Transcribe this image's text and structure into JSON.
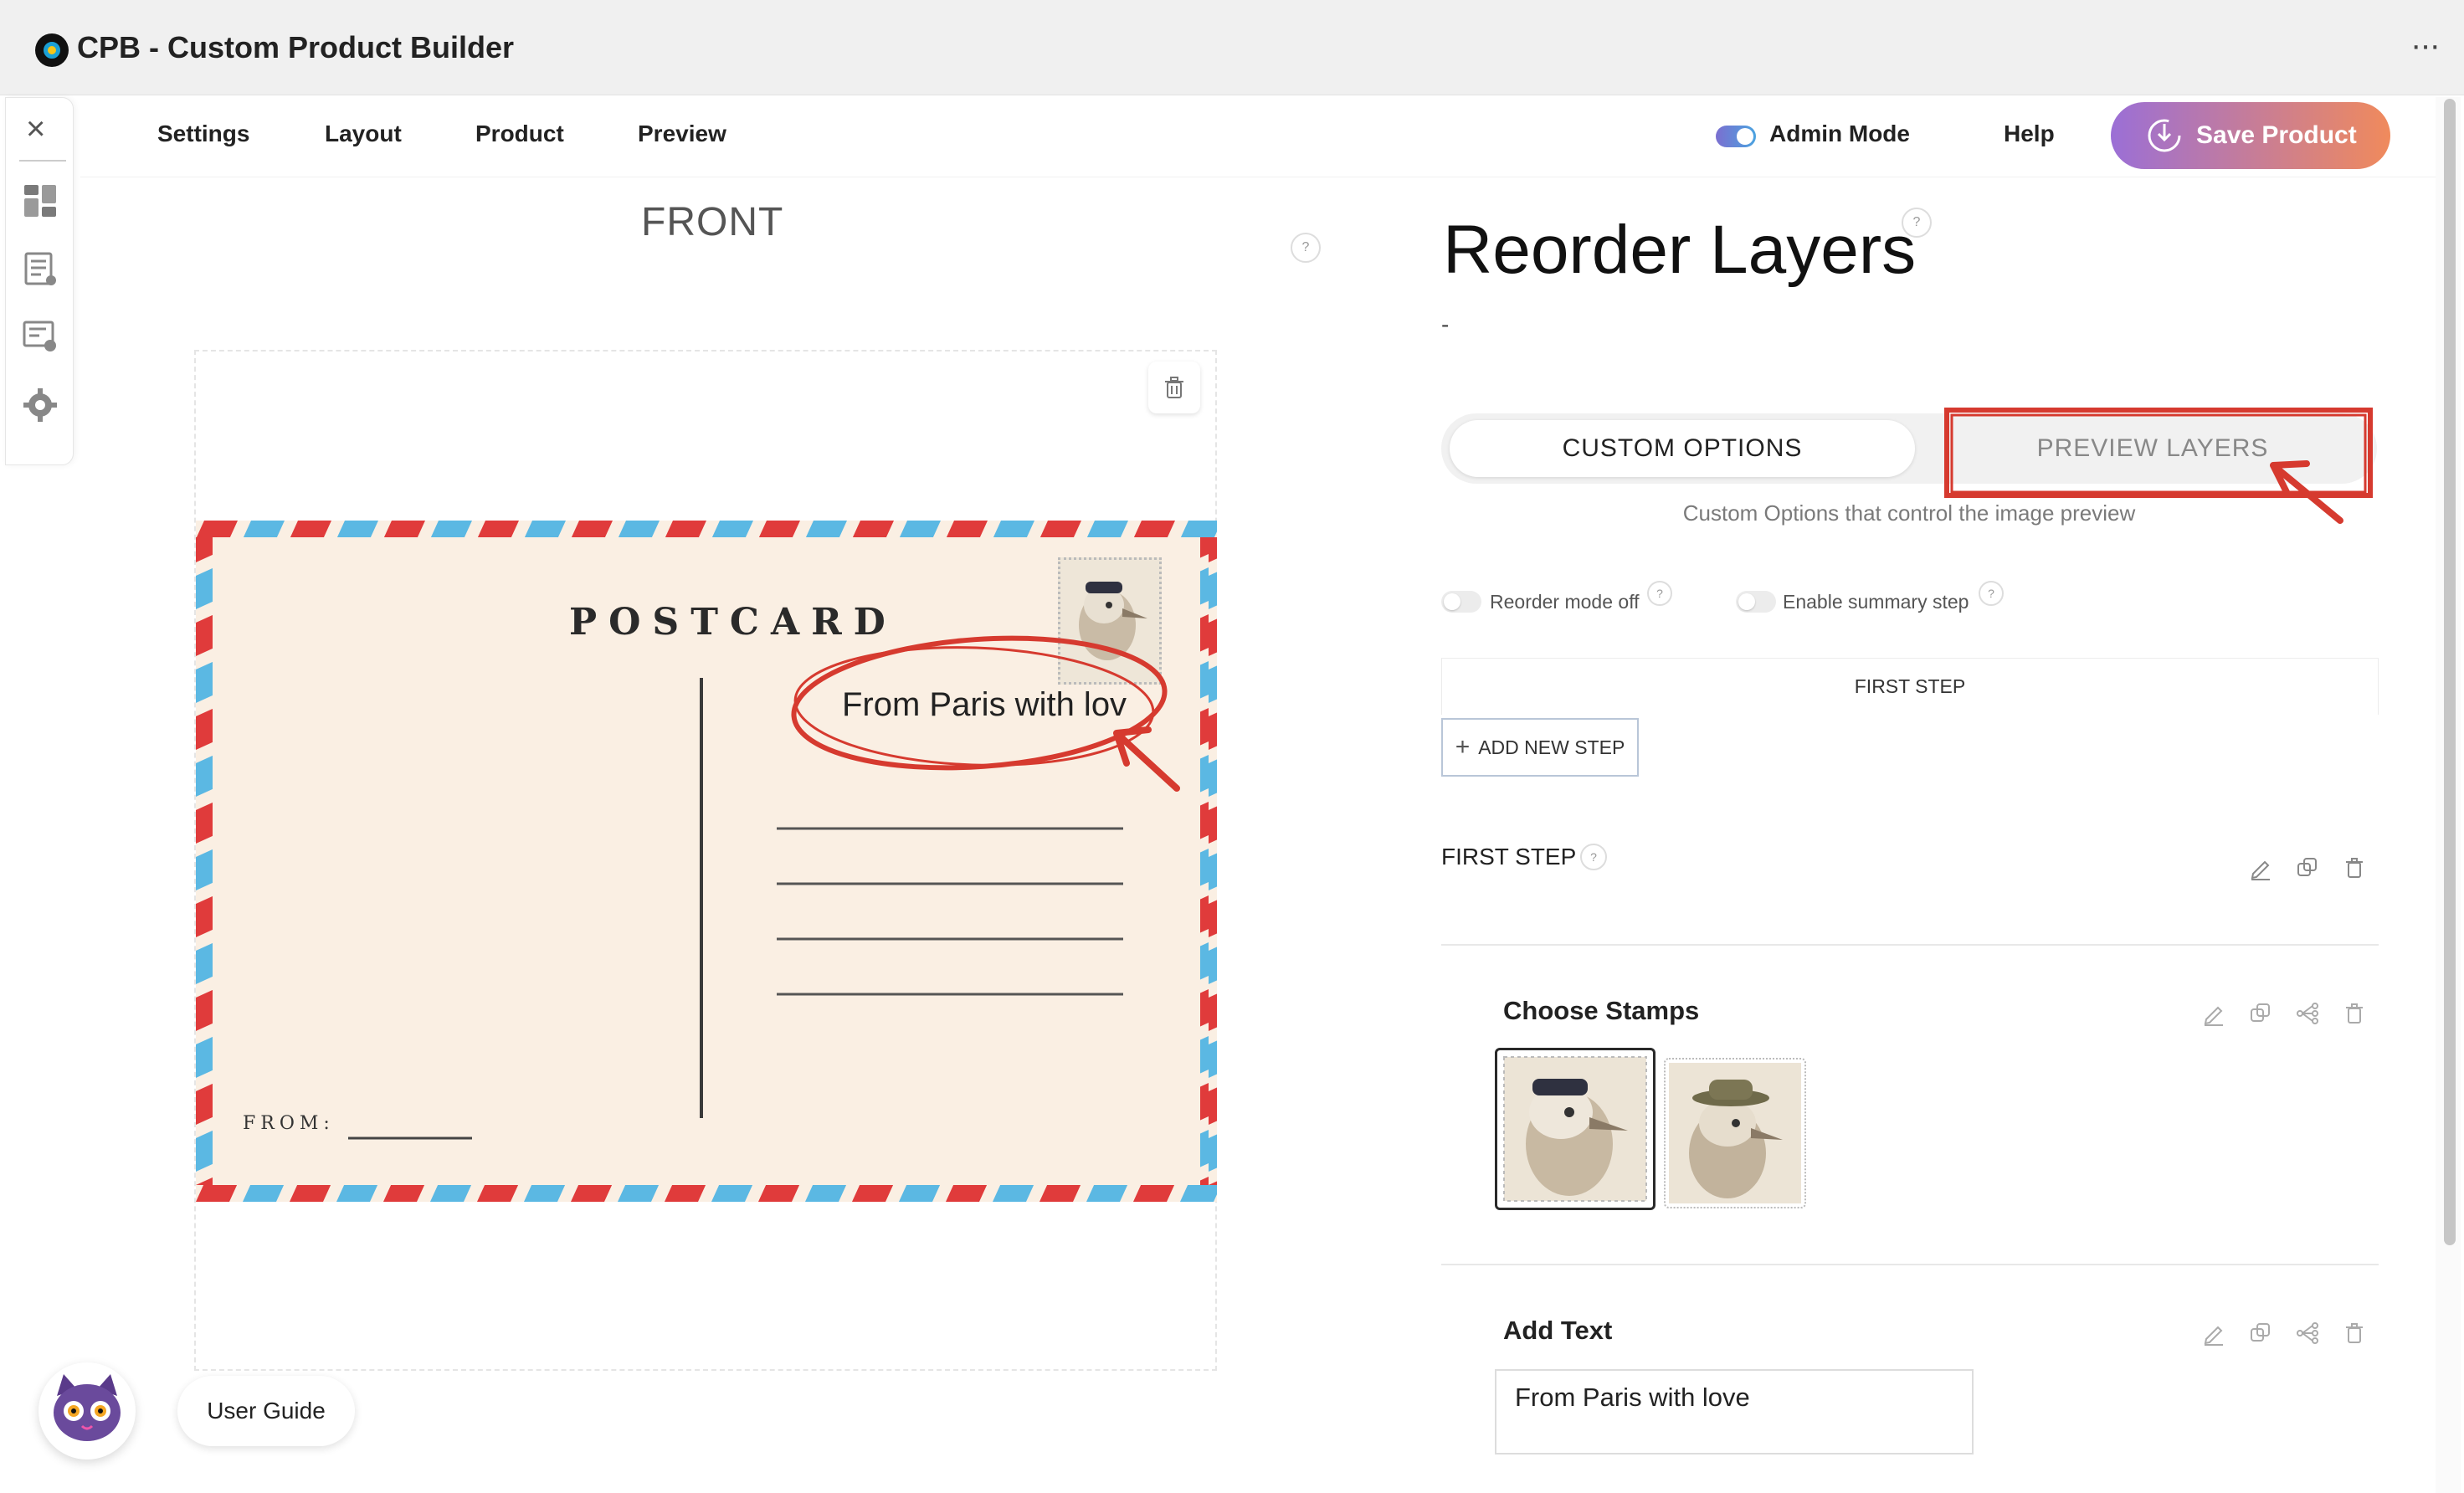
{
  "app": {
    "title": "CPB - Custom Product Builder"
  },
  "nav": {
    "items": [
      "Settings",
      "Layout",
      "Product",
      "Preview"
    ],
    "admin_label": "Admin Mode",
    "help_label": "Help",
    "save_label": "Save Product"
  },
  "preview": {
    "side_label": "FRONT",
    "postcard_title": "POSTCARD",
    "postcard_text": "From Paris with love",
    "from_label": "FROM:"
  },
  "panel": {
    "title": "Reorder Layers",
    "subtitle": "-",
    "tabs": [
      "CUSTOM OPTIONS",
      "PREVIEW LAYERS"
    ],
    "tab_note": "Custom Options that control the image preview",
    "reorder_toggle_label": "Reorder mode off",
    "summary_toggle_label": "Enable summary step",
    "steps_bar_label": "FIRST STEP",
    "add_step_label": "ADD NEW STEP",
    "step_heading": "FIRST STEP",
    "sections": [
      {
        "title": "Choose Stamps"
      },
      {
        "title": "Add Text",
        "input_value": "From Paris with love"
      }
    ]
  },
  "footer": {
    "guide_label": "User Guide"
  },
  "colors": {
    "accent_start": "#9b6fd6",
    "accent_end": "#f08a5c",
    "annotation": "#d63a2f",
    "airmail_red": "#e03b3b",
    "airmail_blue": "#5bb8e3"
  }
}
